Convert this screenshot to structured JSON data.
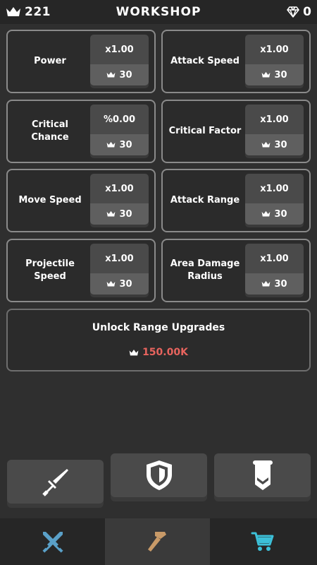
{
  "header": {
    "crowns": "221",
    "title": "WORKSHOP",
    "gems": "0",
    "crown_icon": "crown-icon",
    "gem_icon": "diamond-icon"
  },
  "upgrades": [
    {
      "label": "Power",
      "multiplier": "x1.00",
      "cost": "30"
    },
    {
      "label": "Attack Speed",
      "multiplier": "x1.00",
      "cost": "30"
    },
    {
      "label": "Critical\nChance",
      "multiplier": "%0.00",
      "cost": "30"
    },
    {
      "label": "Critical Factor",
      "multiplier": "x1.00",
      "cost": "30"
    },
    {
      "label": "Move Speed",
      "multiplier": "x1.00",
      "cost": "30"
    },
    {
      "label": "Attack Range",
      "multiplier": "x1.00",
      "cost": "30"
    },
    {
      "label": "Projectile\nSpeed",
      "multiplier": "x1.00",
      "cost": "30"
    },
    {
      "label": "Area Damage\nRadius",
      "multiplier": "x1.00",
      "cost": "30"
    }
  ],
  "unlock": {
    "title": "Unlock Range Upgrades",
    "cost": "150.00K"
  },
  "equipment": [
    "sword-icon",
    "shield-icon",
    "banner-icon"
  ],
  "nav": {
    "tabs": [
      "crossed-swords-icon",
      "hammer-icon",
      "cart-icon"
    ],
    "active_index": 1
  },
  "colors": {
    "background": "#2f2f2f",
    "header": "#262626",
    "card_border": "#8a8a8a",
    "button_top": "#4a4a4a",
    "button_bottom": "#5f5f5f",
    "cost_red": "#e8645e",
    "sword_blue": "#5aa0c8",
    "hammer_tan": "#c89a68",
    "cart_teal": "#3cc0d8"
  }
}
